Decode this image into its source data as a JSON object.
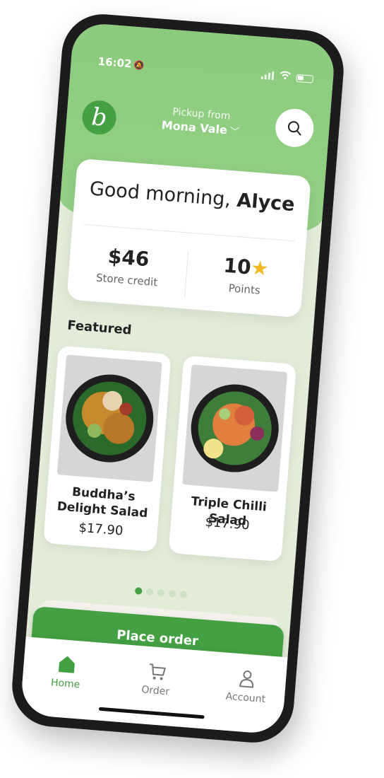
{
  "status_bar": {
    "time": "16:02"
  },
  "header": {
    "logo_letter": "b",
    "pickup_label": "Pickup from",
    "pickup_location": "Mona Vale"
  },
  "greeting": {
    "prefix": "Good morning,",
    "name": "Alyce"
  },
  "stats": {
    "store_credit_value": "$46",
    "store_credit_label": "Store credit",
    "points_value": "10",
    "points_label": "Points"
  },
  "featured": {
    "title": "Featured",
    "items": [
      {
        "name": "Buddha’s Delight Salad",
        "price": "$17.90"
      },
      {
        "name": "Triple Chilli Salad",
        "price": "$17.90"
      }
    ]
  },
  "carousel": {
    "count": 5,
    "active_index": 0
  },
  "actions": {
    "place_order_label": "Place order"
  },
  "tabbar": {
    "tabs": [
      {
        "label": "Home",
        "icon": "home-icon",
        "active": true
      },
      {
        "label": "Order",
        "icon": "cart-icon",
        "active": false
      },
      {
        "label": "Account",
        "icon": "person-icon",
        "active": false
      }
    ]
  },
  "colors": {
    "brand_green": "#44a043",
    "hero_green": "#8ccb7e",
    "background": "#e3ecd9",
    "star": "#f2b920"
  }
}
